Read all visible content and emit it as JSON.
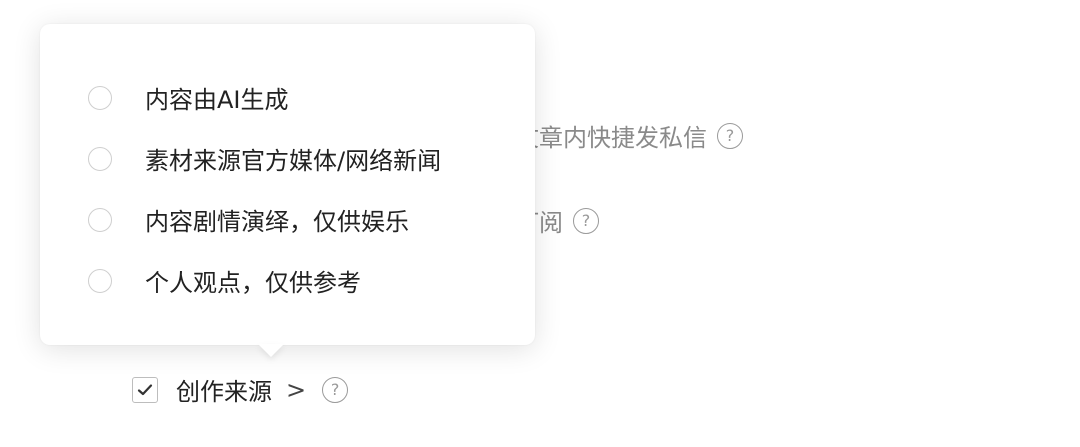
{
  "background_options": [
    {
      "label": "文章内快捷发私信",
      "icon": "question-circle-icon"
    },
    {
      "label": "订阅",
      "icon": "question-circle-icon"
    }
  ],
  "popover": {
    "options": [
      {
        "label": "内容由AI生成",
        "selected": false
      },
      {
        "label": "素材来源官方媒体/网络新闻",
        "selected": false
      },
      {
        "label": "内容剧情演绎，仅供娱乐",
        "selected": false
      },
      {
        "label": "个人观点，仅供参考",
        "selected": false
      }
    ]
  },
  "creation_source": {
    "checked": true,
    "label": "创作来源",
    "chevron": ">",
    "help": "?"
  },
  "help_glyph": "?"
}
